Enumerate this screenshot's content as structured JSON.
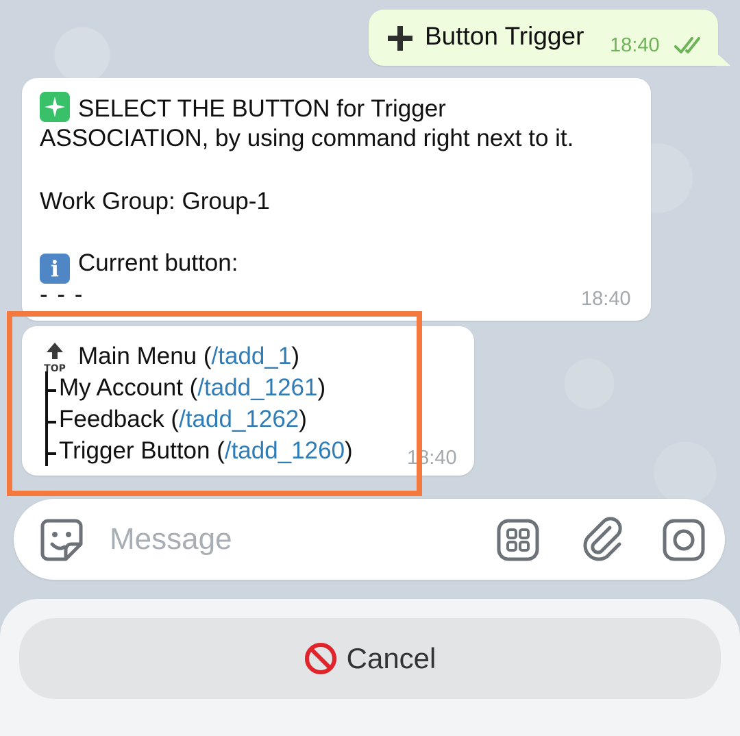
{
  "outgoing": {
    "text": "Button Trigger",
    "time": "18:40",
    "plus_icon": "plus-icon",
    "status_icon": "double-check-icon"
  },
  "incoming_main": {
    "line1": "SELECT THE BUTTON for Trigger",
    "line2": "ASSOCIATION, by using command right next to it.",
    "work_group": "Work Group: Group-1",
    "current_button_label": "Current button:",
    "separator": "- - -",
    "time": "18:40",
    "sparkle_icon": "sparkle-icon",
    "info_icon": "info-icon"
  },
  "incoming_menu": {
    "items": [
      {
        "label": "Main Menu (",
        "command": "/tadd_1",
        "close": ")"
      },
      {
        "label": "My Account (",
        "command": "/tadd_1261",
        "close": ")"
      },
      {
        "label": "Feedback (",
        "command": "/tadd_1262",
        "close": ")"
      },
      {
        "label": "Trigger Button (",
        "command": "/tadd_1260",
        "close": ")"
      }
    ],
    "top_icon_text": "TOP",
    "time": "18:40"
  },
  "composer": {
    "placeholder": "Message",
    "icons": [
      "sticker-icon",
      "apps-grid-icon",
      "attach-icon",
      "camera-icon"
    ]
  },
  "keyboard": {
    "cancel_label": "Cancel",
    "cancel_icon": "prohibited-icon"
  },
  "colors": {
    "highlight": "#f4793f",
    "link": "#2f7cb7",
    "outgoing_bubble": "#effdde",
    "outgoing_time": "#6fb25a"
  }
}
